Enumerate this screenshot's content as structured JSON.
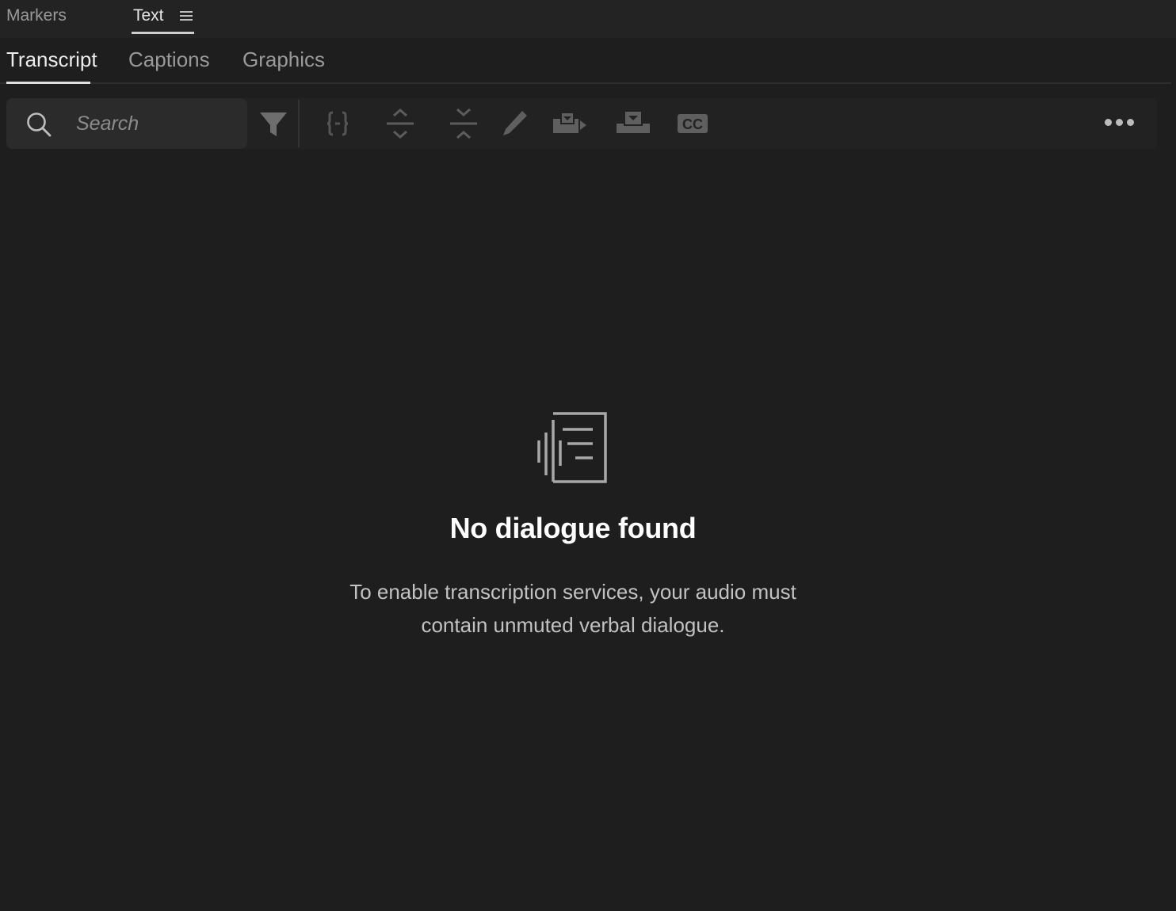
{
  "panel": {
    "tabs": [
      {
        "label": "Markers",
        "active": false
      },
      {
        "label": "Text",
        "active": true
      }
    ]
  },
  "subtabs": [
    {
      "label": "Transcript",
      "active": true
    },
    {
      "label": "Captions",
      "active": false
    },
    {
      "label": "Graphics",
      "active": false
    }
  ],
  "toolbar": {
    "search_placeholder": "Search",
    "icons": [
      "search-icon",
      "filter-icon",
      "split-icon",
      "expand-icon",
      "collapse-icon",
      "edit-icon",
      "export-icon",
      "import-icon",
      "cc-icon",
      "more-icon"
    ],
    "cc_label": "CC"
  },
  "empty_state": {
    "title": "No dialogue found",
    "description": "To enable transcription services, your audio must contain unmuted verbal dialogue."
  },
  "colors": {
    "background": "#1e1e1e",
    "header": "#232323",
    "active_underline": "#e0e0e0",
    "icon_disabled": "#5a5a5a"
  }
}
